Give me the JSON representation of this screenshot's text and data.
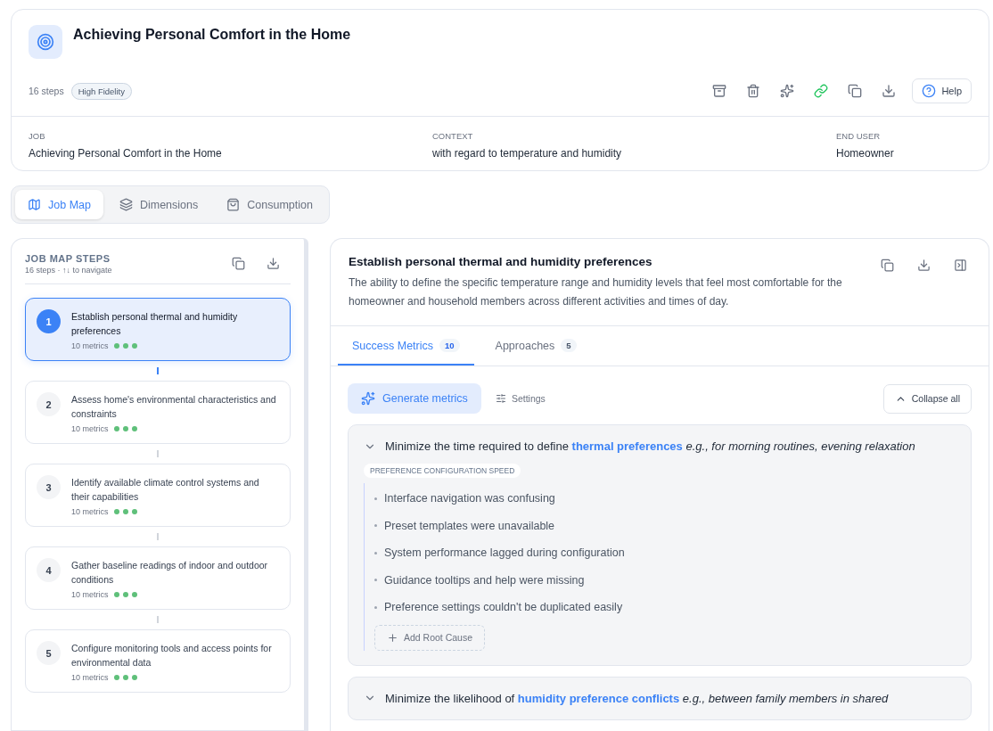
{
  "header": {
    "title": "Achieving Personal Comfort in the Home",
    "steps_count": "16 steps",
    "badge": "High Fidelity",
    "help_label": "Help",
    "fields": [
      {
        "label": "JOB",
        "value": "Achieving Personal Comfort in the Home"
      },
      {
        "label": "CONTEXT",
        "value": "with regard to temperature and humidity"
      },
      {
        "label": "END USER",
        "value": "Homeowner"
      }
    ]
  },
  "view_tabs": [
    {
      "label": "Job Map",
      "kind": "map",
      "selected": true
    },
    {
      "label": "Dimensions",
      "kind": "layers",
      "selected": false
    },
    {
      "label": "Consumption",
      "kind": "bag",
      "selected": false
    }
  ],
  "sidebar": {
    "title": "JOB MAP STEPS",
    "subtitle": "16 steps · ↑↓ to navigate",
    "steps": [
      {
        "number": "1",
        "title": "Establish personal thermal and humidity preferences",
        "metrics": "10 metrics",
        "selected": true
      },
      {
        "number": "2",
        "title": "Assess home's environmental characteristics and constraints",
        "metrics": "10 metrics",
        "selected": false
      },
      {
        "number": "3",
        "title": "Identify available climate control systems and their capabilities",
        "metrics": "10 metrics",
        "selected": false
      },
      {
        "number": "4",
        "title": "Gather baseline readings of indoor and outdoor conditions",
        "metrics": "10 metrics",
        "selected": false
      },
      {
        "number": "5",
        "title": "Configure monitoring tools and access points for environmental data",
        "metrics": "10 metrics",
        "selected": false
      }
    ]
  },
  "detail": {
    "title": "Establish personal thermal and humidity preferences",
    "description": "The ability to define the specific temperature range and humidity levels that feel most comfortable for the homeowner and household members across different activities and times of day.",
    "tabs": [
      {
        "label": "Success Metrics",
        "count": "10",
        "selected": true
      },
      {
        "label": "Approaches",
        "count": "5",
        "selected": false
      }
    ],
    "generate_label": "Generate metrics",
    "settings_label": "Settings",
    "collapse_label": "Collapse all",
    "metrics": [
      {
        "statement": "Minimize the time required to define **thermal preferences** *e.g., for morning routines, evening relaxation*",
        "expanded": true,
        "tag": "PREFERENCE CONFIGURATION SPEED",
        "root_causes": [
          "Interface navigation was confusing",
          "Preset templates were unavailable",
          "System performance lagged during configuration",
          "Guidance tooltips and help were missing",
          "Preference settings couldn't be duplicated easily"
        ],
        "add_label": "Add Root Cause"
      },
      {
        "statement": "Minimize the likelihood of **humidity preference conflicts** *e.g., between family members in shared*",
        "expanded": true
      }
    ]
  }
}
